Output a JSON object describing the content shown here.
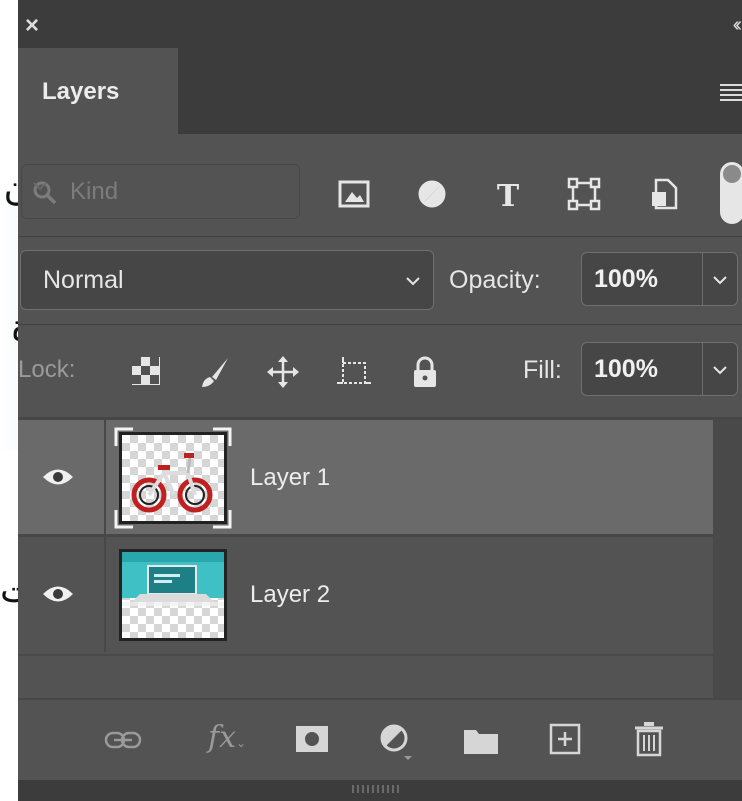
{
  "background": {
    "glyph_1": "ن",
    "glyph_2": "ة",
    "glyph_3": "ت."
  },
  "panel": {
    "tab_label": "Layers",
    "filter": {
      "placeholder": "Kind",
      "icons": [
        "image-filter-icon",
        "adjustment-filter-icon",
        "type-filter-icon",
        "shape-filter-icon",
        "smart-object-filter-icon",
        "filter-toggle-icon"
      ]
    },
    "blend_mode": "Normal",
    "opacity_label": "Opacity:",
    "opacity_value": "100%",
    "lock_label": "Lock:",
    "lock_icons": [
      "lock-transparent-icon",
      "lock-image-icon",
      "lock-position-icon",
      "lock-artboard-icon",
      "lock-all-icon"
    ],
    "fill_label": "Fill:",
    "fill_value": "100%",
    "layers": [
      {
        "name": "Layer 1",
        "visible": true,
        "selected": true,
        "thumbnail": "bicycle"
      },
      {
        "name": "Layer 2",
        "visible": true,
        "selected": false,
        "thumbnail": "laptop"
      }
    ],
    "bottom_icons": [
      "link-layers-icon",
      "fx-icon",
      "mask-icon",
      "adjustment-layer-icon",
      "group-folder-icon",
      "new-layer-icon",
      "trash-icon"
    ],
    "fx_text": "fx"
  },
  "colors": {
    "panel_bg": "#535353",
    "selected_layer": "#6a6a6a",
    "dark_bar": "#3c3c3c"
  }
}
